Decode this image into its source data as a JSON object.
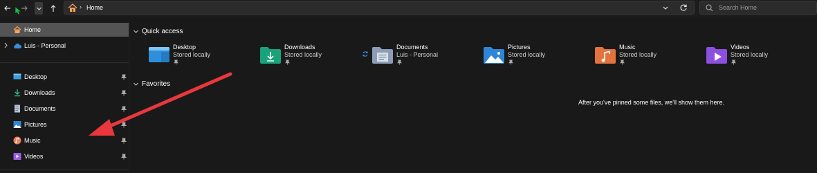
{
  "toolbar": {
    "back_label": "Back",
    "forward_label": "Forward",
    "recent_label": "Recent locations",
    "up_label": "Up"
  },
  "address": {
    "crumb": "Home"
  },
  "search": {
    "placeholder": "Search Home"
  },
  "sidebar": {
    "home": "Home",
    "onedrive": "Luis - Personal",
    "items": [
      {
        "label": "Desktop",
        "icon": "desktop-icon"
      },
      {
        "label": "Downloads",
        "icon": "downloads-icon"
      },
      {
        "label": "Documents",
        "icon": "documents-icon"
      },
      {
        "label": "Pictures",
        "icon": "pictures-icon"
      },
      {
        "label": "Music",
        "icon": "music-icon"
      },
      {
        "label": "Videos",
        "icon": "videos-icon"
      }
    ]
  },
  "quick_access": {
    "title": "Quick access",
    "items": [
      {
        "name": "Desktop",
        "sub": "Stored locally"
      },
      {
        "name": "Downloads",
        "sub": "Stored locally"
      },
      {
        "name": "Documents",
        "sub": "Luis - Personal"
      },
      {
        "name": "Pictures",
        "sub": "Stored locally"
      },
      {
        "name": "Music",
        "sub": "Stored locally"
      },
      {
        "name": "Videos",
        "sub": "Stored locally"
      }
    ]
  },
  "favorites": {
    "title": "Favorites",
    "empty_message": "After you've pinned some files, we'll show them here."
  },
  "colors": {
    "accent_arrow": "#e8383d",
    "selected_row": "#545454",
    "background": "#191919"
  }
}
